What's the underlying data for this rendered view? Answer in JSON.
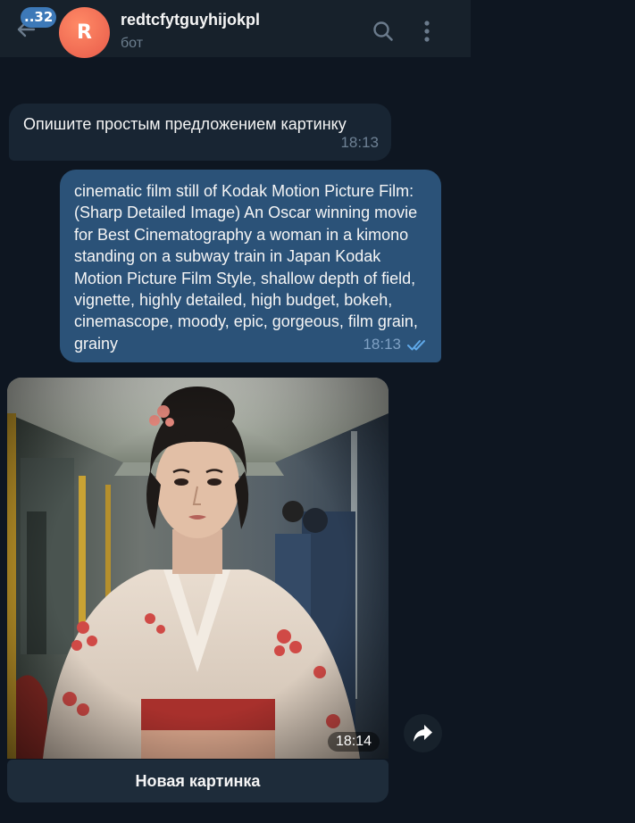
{
  "header": {
    "unread_count": "..32",
    "avatar_letter": "R",
    "chat_title": "redtcfytguyhijokpl",
    "chat_subtitle": "бот",
    "avatar_color": "#e85b4a"
  },
  "messages": {
    "incoming": {
      "text": "Опишите простым предложением картинку",
      "time": "18:13"
    },
    "outgoing": {
      "text": "cinematic film still of Kodak Motion Picture Film: (Sharp Detailed Image) An Oscar winning movie for Best Cinematography a woman in a kimono standing on a subway train in Japan Kodak Motion Picture Film Style, shallow depth of field, vignette, highly detailed, high budget, bokeh, cinemascope, moody, epic, gorgeous, film grain, grainy",
      "time": "18:13",
      "status_icon": "double-check-icon"
    },
    "photo": {
      "time": "18:14"
    }
  },
  "keyboard": {
    "button_label": "Новая картинка"
  },
  "colors": {
    "background": "#0e1621",
    "header": "#17212b",
    "incoming_bubble": "#182533",
    "outgoing_bubble": "#2b5278",
    "accent": "#3d79b8"
  }
}
